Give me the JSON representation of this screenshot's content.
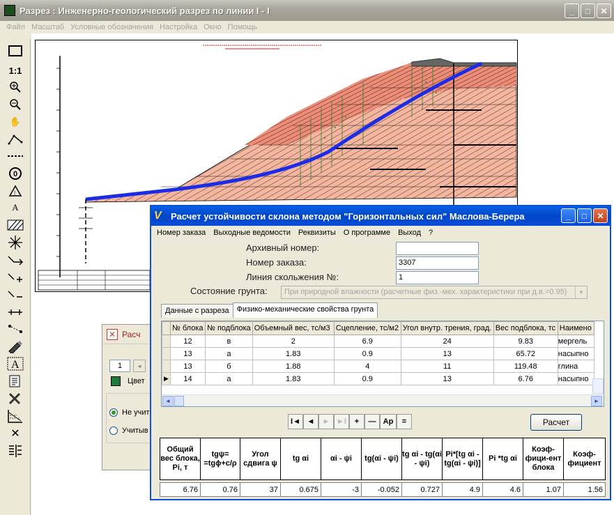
{
  "main_window": {
    "title": "Разрез : Инженерно-геологический разрез по линии I - I",
    "menu": [
      "Файл",
      "Масштаб",
      "Условные обозначения",
      "Настройка",
      "Окно",
      "Помощь"
    ]
  },
  "toolbar": {
    "scale_label": "1:1"
  },
  "small_window": {
    "title_partial": "Расч",
    "page_field": "1",
    "color_label": "Цвет",
    "radio_1": "Не учит",
    "radio_2": "Учитыв"
  },
  "dialog": {
    "title": "Расчет устойчивости склона методом \"Горизонтальных сил\" Маслова-Берера",
    "menu": [
      "Номер заказа",
      "Выходные ведомости",
      "Реквизиты",
      "О программе",
      "Выход",
      "?"
    ],
    "fields": {
      "archive_label": "Архивный номер:",
      "archive_value": "",
      "order_label": "Номер заказа:",
      "order_value": "3307",
      "slip_label": "Линия скольжения №:",
      "slip_value": "1",
      "soil_state_label": "Состояние грунта:",
      "soil_state_value": "При природной влажности (расчетные физ.-мех. характеристики при д.в.=0.95)"
    },
    "tabs": [
      "Данные с разреза",
      "Физико-механические свойства грунта"
    ],
    "grid": {
      "columns": [
        "№ блока",
        "№ подблока",
        "Объемный вес, тс/м3",
        "Сцепление, тс/м2",
        "Угол внутр. трения, град.",
        "Вес подблока, тс",
        "Наимено"
      ],
      "rows": [
        [
          "12",
          "в",
          "2",
          "6.9",
          "24",
          "9.83",
          "мергель"
        ],
        [
          "13",
          "а",
          "1.83",
          "0.9",
          "13",
          "65.72",
          "насыпно"
        ],
        [
          "13",
          "б",
          "1.88",
          "4",
          "11",
          "119.48",
          "глина"
        ],
        [
          "14",
          "а",
          "1.83",
          "0.9",
          "13",
          "6.76",
          "насыпно"
        ]
      ]
    },
    "nav": {
      "first": "I◄",
      "prev": "◄",
      "next": "►",
      "last": "►I",
      "add": "+",
      "remove": "—",
      "ap": "Ap",
      "eq": "="
    },
    "calc_button": "Расчет",
    "results": {
      "headers": [
        "Общий вес блока, Pi, т",
        "tgψ= =tgϕ+c/ρ",
        "Угол сдвига ψ",
        "tg αi",
        "αi - ψi",
        "tg(αi - ψi)",
        "tg αi - tg(αi - ψi)",
        "Pi*[tg αi - tg(αi - ψi)]",
        "Pi *tg αi",
        "Коэф-фици-ент блока",
        "Коэф-фициент"
      ],
      "values": [
        "6.76",
        "0.76",
        "37",
        "0.675",
        "-3",
        "-0.052",
        "0.727",
        "4.9",
        "4.6",
        "1.07",
        "1.56"
      ]
    }
  }
}
